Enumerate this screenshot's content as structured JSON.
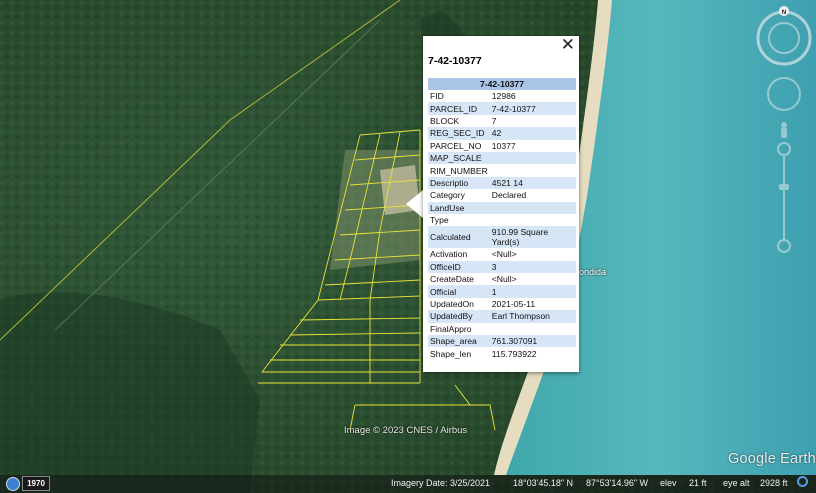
{
  "popup": {
    "title": "7-42-10377",
    "header": "7-42-10377",
    "close_label": "✕",
    "rows": [
      {
        "k": "FID",
        "v": "12986"
      },
      {
        "k": "PARCEL_ID",
        "v": "7-42-10377"
      },
      {
        "k": "BLOCK",
        "v": "7"
      },
      {
        "k": "REG_SEC_ID",
        "v": "42"
      },
      {
        "k": "PARCEL_NO",
        "v": "10377"
      },
      {
        "k": "MAP_SCALE",
        "v": ""
      },
      {
        "k": "RIM_NUMBER",
        "v": ""
      },
      {
        "k": "Descriptio",
        "v": "4521 14"
      },
      {
        "k": "Category",
        "v": "Declared"
      },
      {
        "k": "LandUse",
        "v": ""
      },
      {
        "k": "Type",
        "v": ""
      },
      {
        "k": "Calculated",
        "v": "910.99 Square Yard(s)"
      },
      {
        "k": "Activation",
        "v": "<Null>"
      },
      {
        "k": "OfficeID",
        "v": "3"
      },
      {
        "k": "CreateDate",
        "v": "<Null>"
      },
      {
        "k": "Official",
        "v": "1"
      },
      {
        "k": "UpdatedOn",
        "v": "2021-05-11"
      },
      {
        "k": "UpdatedBy",
        "v": "Earl Thompson"
      },
      {
        "k": "FinalAppro",
        "v": ""
      },
      {
        "k": "Shape_area",
        "v": "761.307091"
      },
      {
        "k": "Shape_len",
        "v": "115.793922"
      }
    ]
  },
  "map": {
    "credit": "Image © 2023 CNES / Airbus",
    "place_label": "ondida",
    "brand": "Google Earth",
    "compass_label": "N"
  },
  "status": {
    "history_year": "1970",
    "imagery_date": "Imagery Date: 3/25/2021",
    "lat": "18°03'45.18\" N",
    "lon": "87°53'14.96\" W",
    "elev_label": "elev",
    "elev_value": "21 ft",
    "eye_label": "eye alt",
    "eye_value": "2928 ft"
  },
  "colors": {
    "forest": "#2f5130",
    "sea": "#4fb0b6",
    "sand": "#d9cdb0",
    "parcel_lines": "#e8e23a",
    "popup_header": "#a9c4e6",
    "popup_alt_row": "#d7e6f7"
  }
}
